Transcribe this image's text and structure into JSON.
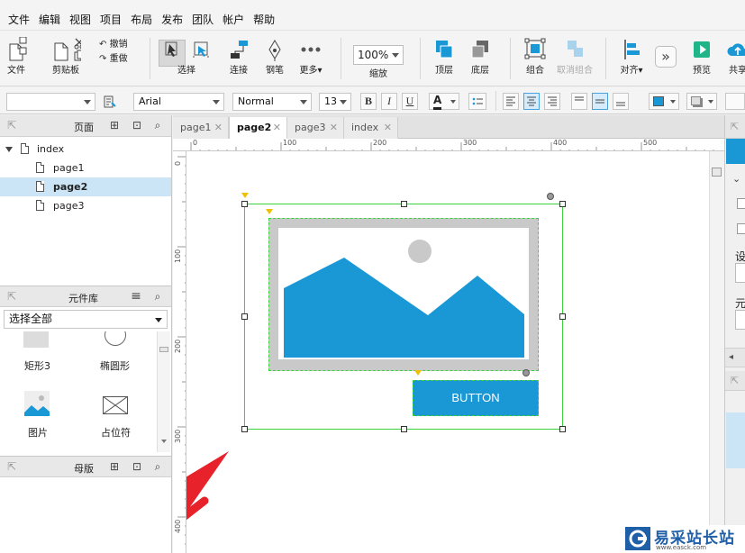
{
  "menubar": {
    "items": [
      "文件",
      "编辑",
      "视图",
      "项目",
      "布局",
      "发布",
      "团队",
      "帐户",
      "帮助"
    ]
  },
  "toolbar": {
    "file_label": "文件",
    "clipboard_label": "剪贴板",
    "undo_label": "撤销",
    "redo_label": "重做",
    "select_label": "选择",
    "connect_label": "连接",
    "pen_label": "钢笔",
    "more_label": "更多▾",
    "zoom_value": "100%",
    "zoom_label": "缩放",
    "top_label": "顶层",
    "bottom_label": "底层",
    "group_label": "组合",
    "ungroup_label": "取消组合",
    "align_label": "对齐▾",
    "preview_label": "预览",
    "share_label": "共享"
  },
  "formatbar": {
    "style_value": "",
    "font_value": "Arial",
    "weight_value": "Normal",
    "size_value": "13",
    "bold": "B",
    "italic": "I",
    "underline": "U",
    "font_color": "A"
  },
  "pages_panel": {
    "title": "页面",
    "root": "index",
    "pages": [
      "page1",
      "page2",
      "page3"
    ],
    "selected": "page2"
  },
  "library_panel": {
    "title": "元件库",
    "filter_value": "选择全部",
    "items": [
      "矩形3",
      "椭圆形",
      "图片",
      "占位符"
    ]
  },
  "masters_panel": {
    "title": "母版"
  },
  "tabs": {
    "items": [
      "page1",
      "page2",
      "page3",
      "index"
    ],
    "active": "page2"
  },
  "ruler": {
    "h_ticks": [
      "0",
      "100",
      "200",
      "300",
      "400",
      "500"
    ],
    "v_ticks": [
      "0",
      "100",
      "200",
      "300",
      "400"
    ]
  },
  "canvas": {
    "button_text": "BUTTON"
  },
  "rightpanel": {
    "label_set": "设",
    "label_elem": "元"
  },
  "watermark": {
    "title": "易采站长站",
    "url": "www.easck.com"
  },
  "colors": {
    "accent": "#1a97d5",
    "image_fill": "#1a97d5",
    "selection_green": "#3dd23d",
    "arrow_red": "#e8222a"
  }
}
